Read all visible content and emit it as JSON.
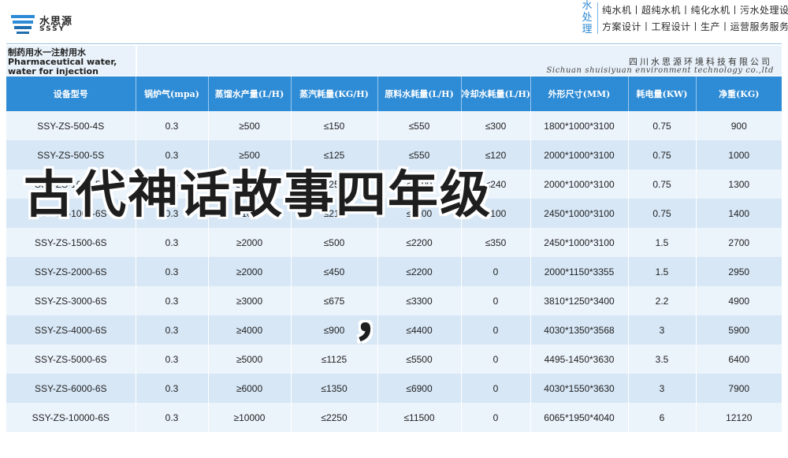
{
  "brand": {
    "logo_cn": "水思源",
    "logo_en": "SSSY",
    "accent_color": "#2e8bd5"
  },
  "service": {
    "side_chars": [
      "水",
      "处",
      "理"
    ],
    "line1": "纯水机丨超纯水机丨纯化水机丨污水处理设备",
    "line2": "方案设计丨工程设计丨生产丨运营服务服务"
  },
  "title": {
    "cn": "制药用水一注射用水",
    "en": "Pharmaceutical water, water for injection"
  },
  "company": {
    "cn": "四川水思源环境科技有限公司",
    "en": "Sichuan shuisiyuan environment technology co.,ltd"
  },
  "table": {
    "headers": [
      "设备型号",
      "锅炉气(mpa)",
      "蒸馏水产量(L/H)",
      "蒸汽耗量(KG/H)",
      "原料水耗量(L/H)",
      "冷却水耗量(L/H)",
      "外形尺寸(MM)",
      "耗电量(KW)",
      "净重(KG)"
    ],
    "rows": [
      [
        "SSY-ZS-500-4S",
        "0.3",
        "≥500",
        "≤150",
        "≤550",
        "≤300",
        "1800*1000*3100",
        "0.75",
        "900"
      ],
      [
        "SSY-ZS-500-5S",
        "0.3",
        "≥500",
        "≤125",
        "≤550",
        "≤120",
        "2000*1000*3100",
        "0.75",
        "1000"
      ],
      [
        "SSY-ZS-1000-5S",
        "0.3",
        "≥1000",
        "≤250",
        "≤1100",
        "≤240",
        "2000*1000*3100",
        "0.75",
        "1300"
      ],
      [
        "SSY-ZS-1000-6S",
        "0.3",
        "≥1000",
        "≤215",
        "≤1100",
        "≤100",
        "2450*1000*3100",
        "0.75",
        "1400"
      ],
      [
        "SSY-ZS-1500-6S",
        "0.3",
        "≥2000",
        "≤500",
        "≤2200",
        "≤350",
        "2450*1000*3100",
        "1.5",
        "2700"
      ],
      [
        "SSY-ZS-2000-6S",
        "0.3",
        "≥2000",
        "≤450",
        "≤2200",
        "0",
        "2000*1150*3355",
        "1.5",
        "2950"
      ],
      [
        "SSY-ZS-3000-6S",
        "0.3",
        "≥3000",
        "≤675",
        "≤3300",
        "0",
        "3810*1250*3400",
        "2.2",
        "4900"
      ],
      [
        "SSY-ZS-4000-6S",
        "0.3",
        "≥4000",
        "≤900",
        "≤4400",
        "0",
        "4030*1350*3568",
        "3",
        "5900"
      ],
      [
        "SSY-ZS-5000-6S",
        "0.3",
        "≥5000",
        "≤1125",
        "≤5500",
        "0",
        "4495-1450*3630",
        "3.5",
        "6400"
      ],
      [
        "SSY-ZS-6000-6S",
        "0.3",
        "≥6000",
        "≤1350",
        "≤6900",
        "0",
        "4030*1550*3630",
        "3",
        "7900"
      ],
      [
        "SSY-ZS-10000-6S",
        "0.3",
        "≥10000",
        "≤2250",
        "≤11500",
        "0",
        "6065*1950*4040",
        "6",
        "12120"
      ]
    ]
  },
  "overlay": {
    "headline": "古代神话故事四年级",
    "comma": "，"
  }
}
